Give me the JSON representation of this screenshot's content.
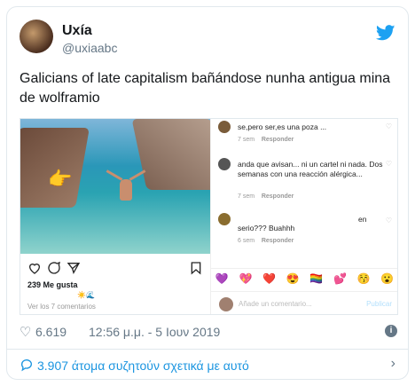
{
  "user": {
    "name": "Uxía",
    "handle": "@uxiaabc"
  },
  "tweet": {
    "text": "Galicians of late capitalism bañándose nunha antigua mina de wolframio"
  },
  "instagram": {
    "likes": "239 Me gusta",
    "view_comments": "Ver los 7 comentarios",
    "comments": [
      {
        "text": "se,pero ser,es una poza ...",
        "age": "7 sem",
        "reply": "Responder"
      },
      {
        "text": "anda que avisan... ni un cartel ni nada. Dos semanas con una reacción alérgica...",
        "age": "7 sem",
        "reply": "Responder"
      },
      {
        "text": "serio??? Buahhh",
        "extra": "en",
        "age": "6 sem",
        "reply": "Responder"
      }
    ],
    "add_comment_placeholder": "Añade un comentario...",
    "publish_label": "Publicar",
    "reactions": [
      "💜",
      "💖",
      "❤️",
      "😍",
      "🏳️‍🌈",
      "💕",
      "😚",
      "😮"
    ],
    "small_emojis": "☀️🌊"
  },
  "footer": {
    "likes_count": "6.619",
    "timestamp": "12:56 μ.μ. - 5 Ιουν 2019"
  },
  "conversation": {
    "text": "3.907 άτομα συζητούν σχετικά με αυτό"
  },
  "colors": {
    "twitter_blue": "#1da1f2",
    "link_blue": "#1b95e0",
    "muted": "#657786"
  }
}
